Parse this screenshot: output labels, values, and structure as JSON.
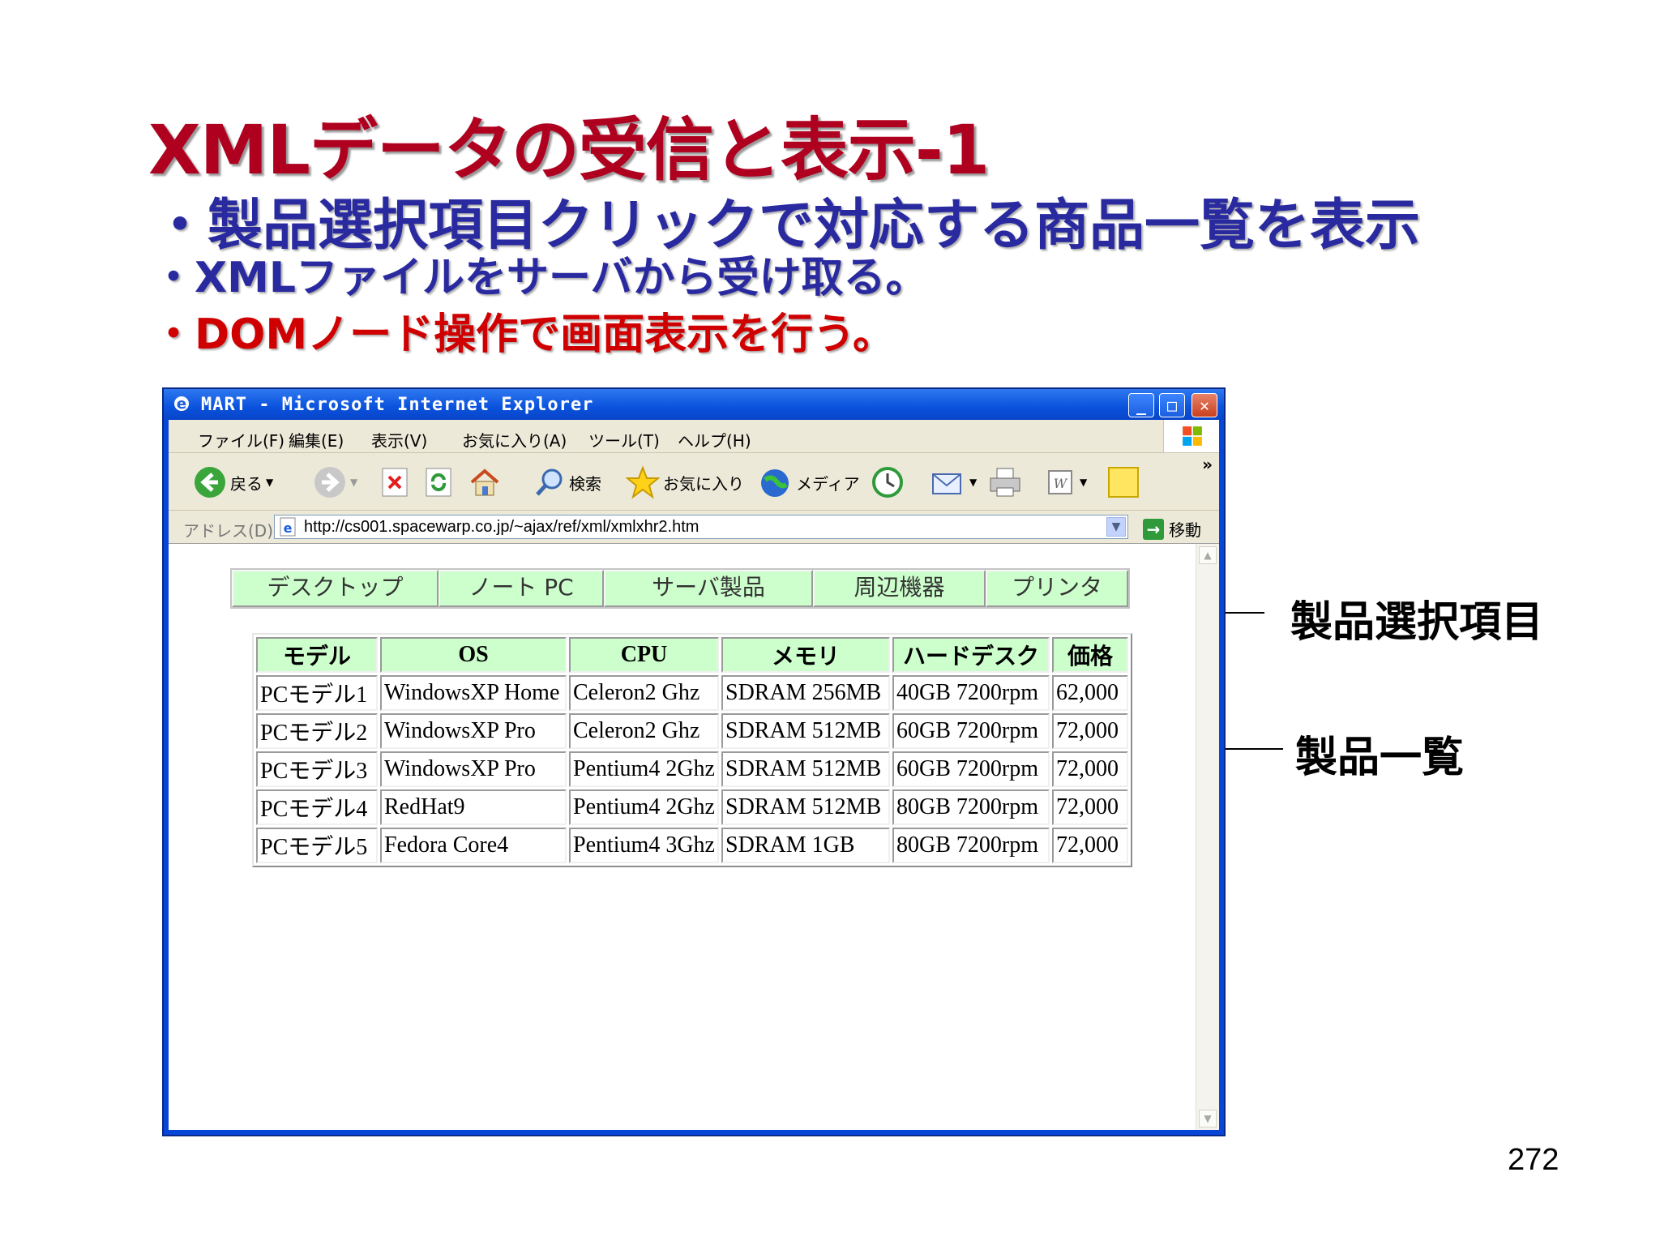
{
  "slide": {
    "title": "XMLデータの受信と表示-1",
    "bullets": [
      "・製品選択項目クリックで対応する商品一覧を表示",
      "・XMLファイルをサーバから受け取る。",
      "・DOMノード操作で画面表示を行う。"
    ],
    "callouts": [
      "製品選択項目",
      "製品一覧"
    ],
    "page_number": "272"
  },
  "browser": {
    "window_title": "MART - Microsoft Internet Explorer",
    "menu": [
      "ファイル(F)",
      "編集(E)",
      "表示(V)",
      "お気に入り(A)",
      "ツール(T)",
      "ヘルプ(H)"
    ],
    "toolbar": {
      "back": "戻る",
      "search": "検索",
      "favorites": "お気に入り",
      "media": "メディア",
      "overflow": "»"
    },
    "address": {
      "label": "アドレス(D)",
      "url": "http://cs001.spacewarp.co.jp/~ajax/ref/xml/xmlxhr2.htm",
      "go": "移動"
    }
  },
  "page": {
    "categories": [
      "デスクトップ",
      "ノート PC",
      "サーバ製品",
      "周辺機器",
      "プリンタ"
    ],
    "table": {
      "headers": [
        "モデル",
        "OS",
        "CPU",
        "メモリ",
        "ハードデスク",
        "価格"
      ],
      "rows": [
        [
          "PCモデル1",
          "WindowsXP Home",
          "Celeron2 Ghz",
          "SDRAM 256MB",
          "40GB 7200rpm",
          "62,000"
        ],
        [
          "PCモデル2",
          "WindowsXP Pro",
          "Celeron2 Ghz",
          "SDRAM 512MB",
          "60GB 7200rpm",
          "72,000"
        ],
        [
          "PCモデル3",
          "WindowsXP Pro",
          "Pentium4 2Ghz",
          "SDRAM 512MB",
          "60GB 7200rpm",
          "72,000"
        ],
        [
          "PCモデル4",
          "RedHat9",
          "Pentium4 2Ghz",
          "SDRAM 512MB",
          "80GB 7200rpm",
          "72,000"
        ],
        [
          "PCモデル5",
          "Fedora Core4",
          "Pentium4 3Ghz",
          "SDRAM 1GB",
          "80GB 7200rpm",
          "72,000"
        ]
      ]
    }
  }
}
